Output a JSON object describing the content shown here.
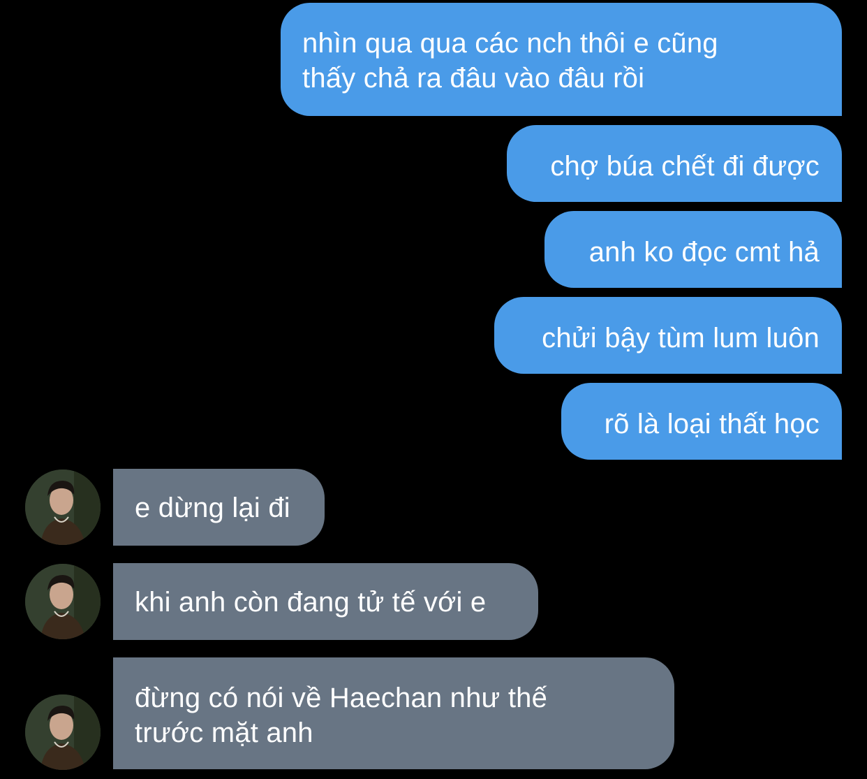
{
  "colors": {
    "background": "#000000",
    "sent_bubble": "#4a9be8",
    "received_bubble": "#687584",
    "text": "#ffffff"
  },
  "messages": [
    {
      "sender": "me",
      "text": "nhìn qua qua các nch thôi e cũng\nthấy chả ra đâu vào đâu rồi"
    },
    {
      "sender": "me",
      "text": "chợ búa chết đi được"
    },
    {
      "sender": "me",
      "text": "anh ko đọc cmt hả"
    },
    {
      "sender": "me",
      "text": "chửi bậy tùm lum luôn"
    },
    {
      "sender": "me",
      "text": "rõ là loại thất học"
    },
    {
      "sender": "contact",
      "text": "e dừng lại đi"
    },
    {
      "sender": "contact",
      "text": "khi anh còn đang tử tế với e"
    },
    {
      "sender": "contact",
      "text": "đừng có nói về Haechan như thế\ntrước mặt anh"
    }
  ],
  "contact": {
    "avatar_icon": "profile-photo"
  }
}
